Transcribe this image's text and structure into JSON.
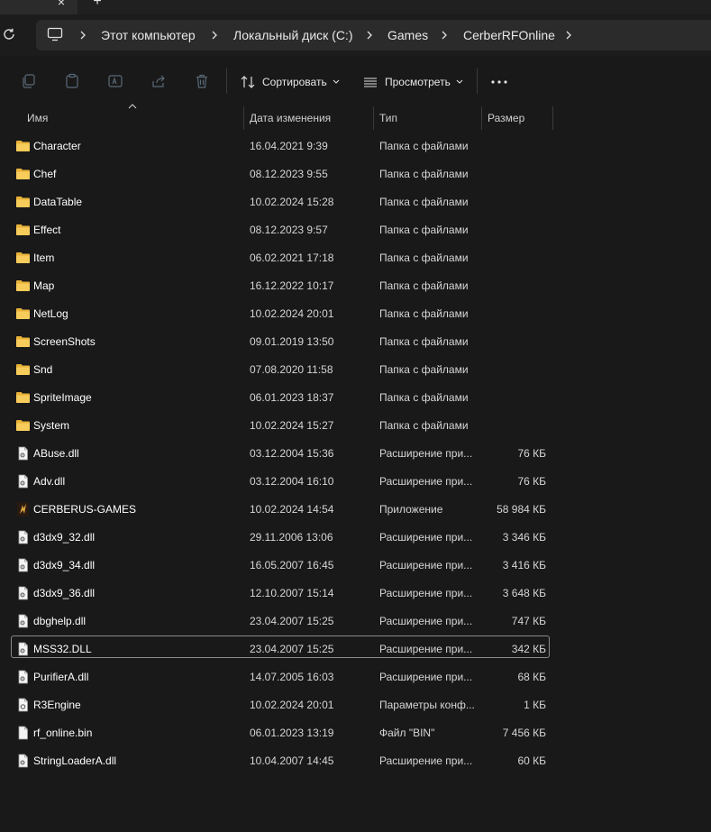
{
  "window": {
    "tab_close_glyph": "×",
    "new_tab_glyph": "+"
  },
  "address": {
    "crumbs": [
      "Этот компьютер",
      "Локальный диск (C:)",
      "Games",
      "CerberRFOnline"
    ]
  },
  "toolbar": {
    "sort_label": "Сортировать",
    "view_label": "Просмотреть"
  },
  "columns": {
    "name": "Имя",
    "date": "Дата изменения",
    "type": "Тип",
    "size": "Размер"
  },
  "files": [
    {
      "name": "Character",
      "date": "16.04.2021 9:39",
      "type": "Папка с файлами",
      "size": "",
      "icon": "folder-icon"
    },
    {
      "name": "Chef",
      "date": "08.12.2023 9:55",
      "type": "Папка с файлами",
      "size": "",
      "icon": "folder-icon"
    },
    {
      "name": "DataTable",
      "date": "10.02.2024 15:28",
      "type": "Папка с файлами",
      "size": "",
      "icon": "folder-icon"
    },
    {
      "name": "Effect",
      "date": "08.12.2023 9:57",
      "type": "Папка с файлами",
      "size": "",
      "icon": "folder-icon"
    },
    {
      "name": "Item",
      "date": "06.02.2021 17:18",
      "type": "Папка с файлами",
      "size": "",
      "icon": "folder-icon"
    },
    {
      "name": "Map",
      "date": "16.12.2022 10:17",
      "type": "Папка с файлами",
      "size": "",
      "icon": "folder-icon"
    },
    {
      "name": "NetLog",
      "date": "10.02.2024 20:01",
      "type": "Папка с файлами",
      "size": "",
      "icon": "folder-icon"
    },
    {
      "name": "ScreenShots",
      "date": "09.01.2019 13:50",
      "type": "Папка с файлами",
      "size": "",
      "icon": "folder-icon"
    },
    {
      "name": "Snd",
      "date": "07.08.2020 11:58",
      "type": "Папка с файлами",
      "size": "",
      "icon": "folder-icon"
    },
    {
      "name": "SpriteImage",
      "date": "06.01.2023 18:37",
      "type": "Папка с файлами",
      "size": "",
      "icon": "folder-icon"
    },
    {
      "name": "System",
      "date": "10.02.2024 15:27",
      "type": "Папка с файлами",
      "size": "",
      "icon": "folder-icon"
    },
    {
      "name": "ABuse.dll",
      "date": "03.12.2004 15:36",
      "type": "Расширение при...",
      "size": "76 КБ",
      "icon": "dll-file-icon"
    },
    {
      "name": "Adv.dll",
      "date": "03.12.2004 16:10",
      "type": "Расширение при...",
      "size": "76 КБ",
      "icon": "dll-file-icon"
    },
    {
      "name": "CERBERUS-GAMES",
      "date": "10.02.2024 14:54",
      "type": "Приложение",
      "size": "58 984 КБ",
      "icon": "app-icon"
    },
    {
      "name": "d3dx9_32.dll",
      "date": "29.11.2006 13:06",
      "type": "Расширение при...",
      "size": "3 346 КБ",
      "icon": "dll-file-icon"
    },
    {
      "name": "d3dx9_34.dll",
      "date": "16.05.2007 16:45",
      "type": "Расширение при...",
      "size": "3 416 КБ",
      "icon": "dll-file-icon"
    },
    {
      "name": "d3dx9_36.dll",
      "date": "12.10.2007 15:14",
      "type": "Расширение при...",
      "size": "3 648 КБ",
      "icon": "dll-file-icon"
    },
    {
      "name": "dbghelp.dll",
      "date": "23.04.2007 15:25",
      "type": "Расширение при...",
      "size": "747 КБ",
      "icon": "dll-file-icon"
    },
    {
      "name": "MSS32.DLL",
      "date": "23.04.2007 15:25",
      "type": "Расширение при...",
      "size": "342 КБ",
      "icon": "dll-file-icon",
      "selected": true
    },
    {
      "name": "PurifierA.dll",
      "date": "14.07.2005 16:03",
      "type": "Расширение при...",
      "size": "68 КБ",
      "icon": "dll-file-icon"
    },
    {
      "name": "R3Engine",
      "date": "10.02.2024 20:01",
      "type": "Параметры конф...",
      "size": "1 КБ",
      "icon": "config-file-icon"
    },
    {
      "name": "rf_online.bin",
      "date": "06.01.2023 13:19",
      "type": "Файл \"BIN\"",
      "size": "7 456 КБ",
      "icon": "bin-file-icon"
    },
    {
      "name": "StringLoaderA.dll",
      "date": "10.04.2007 14:45",
      "type": "Расширение при...",
      "size": "60 КБ",
      "icon": "dll-file-icon"
    }
  ],
  "colors": {
    "background": "#191919",
    "addressbar": "#2b2b2b",
    "folder": "#f2c14e",
    "text": "#ffffff"
  }
}
